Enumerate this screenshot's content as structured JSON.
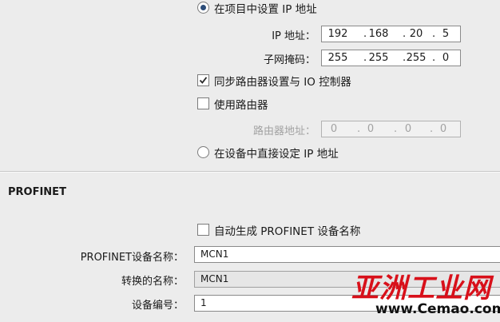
{
  "ip_section": {
    "option_set_in_project": "在项目中设置 IP 地址",
    "ip_address_label": "IP 地址：",
    "ip_address": [
      "192",
      "168",
      "20",
      "5"
    ],
    "subnet_mask_label": "子网掩码：",
    "subnet_mask": [
      "255",
      "255",
      "255",
      "0"
    ],
    "sync_router_label": "同步路由器设置与 IO 控制器",
    "use_router_label": "使用路由器",
    "router_address_label": "路由器地址：",
    "router_address": [
      "0",
      "0",
      "0",
      "0"
    ],
    "option_set_on_device": "在设备中直接设定 IP 地址",
    "selected_option": "set_in_project",
    "sync_router_checked": true,
    "use_router_checked": false
  },
  "profinet_section": {
    "title": "PROFINET",
    "auto_name_label": "自动生成 PROFINET 设备名称",
    "auto_name_checked": false,
    "device_name_label": "PROFINET设备名称：",
    "device_name": "MCN1",
    "converted_name_label": "转换的名称：",
    "converted_name": "MCN1",
    "device_number_label": "设备编号：",
    "device_number": "1"
  },
  "watermark": {
    "text": "亚洲工业网",
    "url": "www.Cemao.com"
  },
  "colors": {
    "background": "#ececec",
    "accent_radio": "#2b4c79",
    "watermark_red": "#d8101a"
  }
}
